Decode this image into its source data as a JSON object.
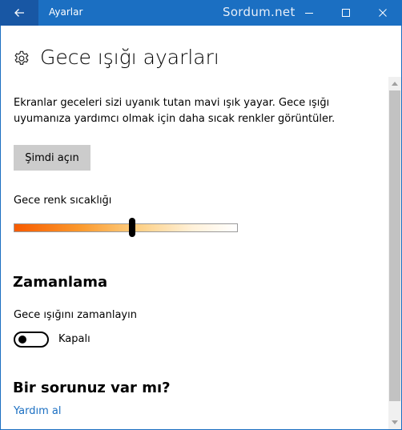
{
  "titlebar": {
    "title": "Ayarlar",
    "watermark": "Sordum.net"
  },
  "icons": {
    "back": "back-arrow-icon",
    "minimize": "minimize-icon",
    "maximize": "maximize-icon",
    "close": "close-icon",
    "settings": "gear-icon"
  },
  "header": {
    "title": "Gece ışığı ayarları"
  },
  "main": {
    "description": "Ekranlar geceleri sizi uyanık tutan mavi ışık yayar. Gece ışığı uyumanıza yardımcı olmak için daha sıcak renkler görüntüler.",
    "turn_on_button": "Şimdi açın",
    "slider": {
      "label": "Gece renk sıcaklığı",
      "value": 0.53
    },
    "schedule": {
      "heading": "Zamanlama",
      "toggle_label": "Gece ışığını zamanlayın",
      "toggle_state": "Kapalı",
      "toggle_on": false
    },
    "help": {
      "heading": "Bir sorunuz var mı?",
      "link": "Yardım al"
    }
  },
  "colors": {
    "accent": "#1b6fc2",
    "titlebar_back": "#1857a4",
    "button_bg": "#cccccc"
  }
}
